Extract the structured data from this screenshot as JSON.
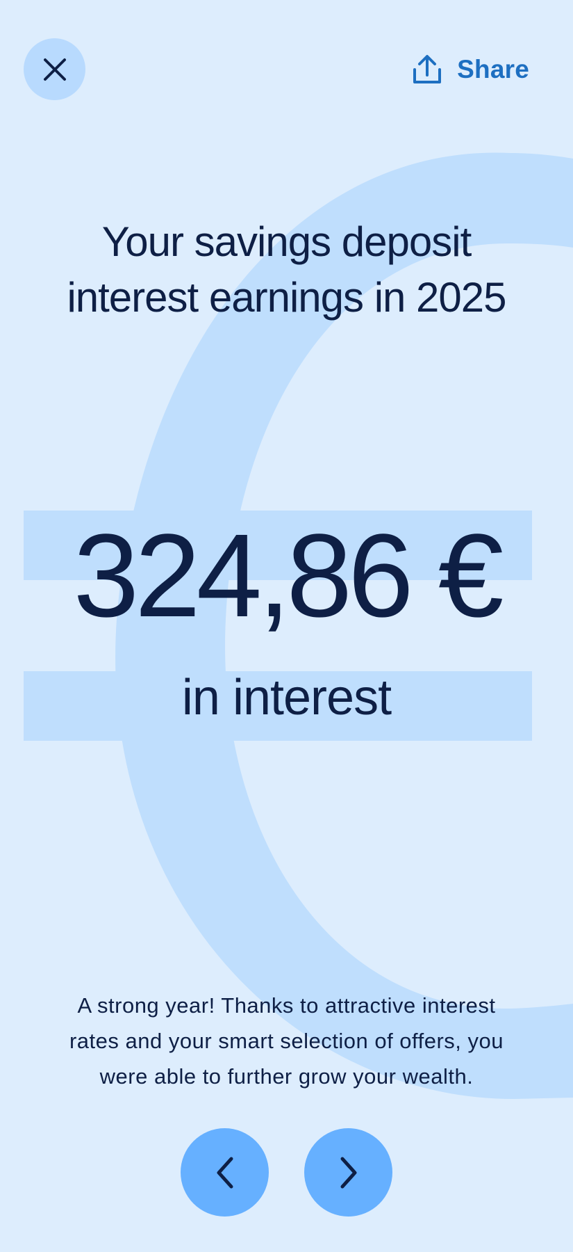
{
  "header": {
    "close_icon": "close-icon",
    "share_icon": "share-upload-icon",
    "share_label": "Share"
  },
  "main": {
    "headline_line1": "Your savings deposit",
    "headline_line2": "interest earnings in 2025",
    "amount": "324,86 €",
    "amount_caption": "in interest",
    "description_line1": "A strong year! Thanks to attractive interest",
    "description_line2": "rates and your smart selection of offers, you",
    "description_line3": "were able to further grow your wealth."
  },
  "footer": {
    "prev_icon": "chevron-left-icon",
    "next_icon": "chevron-right-icon"
  },
  "colors": {
    "background": "#DDEDFD",
    "decoration": "#BFDEFD",
    "close_button": "#B8DAFE",
    "nav_button": "#66B0FF",
    "accent_link": "#1D6FC1",
    "text": "#0E1F45"
  }
}
